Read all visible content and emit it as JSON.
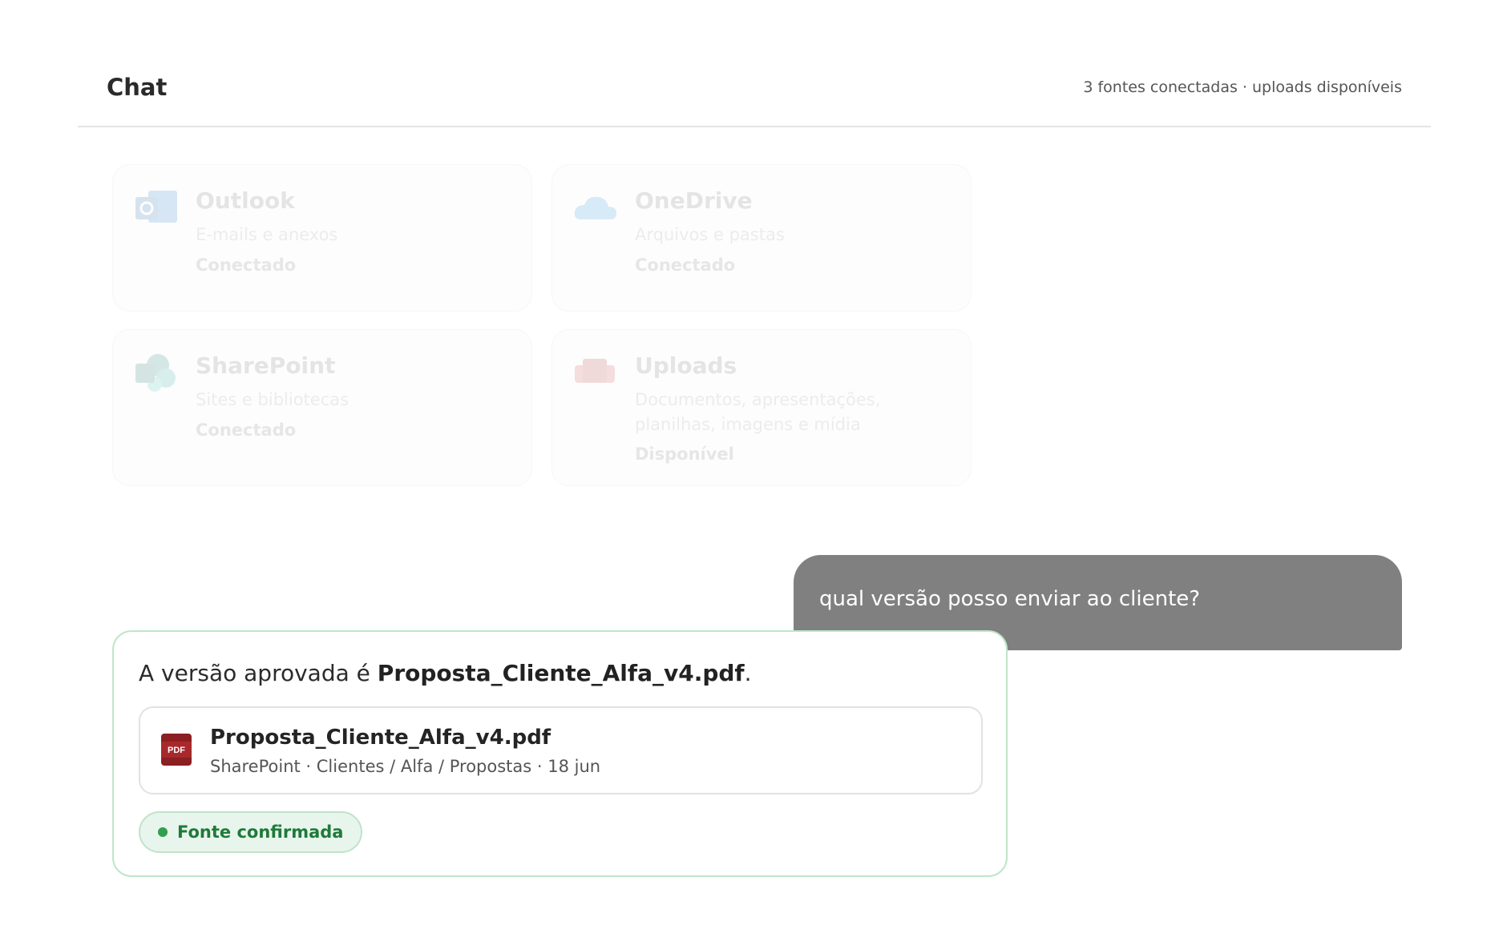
{
  "header": {
    "title": "Chat",
    "status": "3 fontes conectadas · uploads disponíveis"
  },
  "sources": [
    {
      "name": "Outlook",
      "description": "E-mails e anexos",
      "status": "Conectado",
      "icon": "outlook-icon"
    },
    {
      "name": "OneDrive",
      "description": "Arquivos e pastas",
      "status": "Conectado",
      "icon": "onedrive-icon"
    },
    {
      "name": "SharePoint",
      "description": "Sites e bibliotecas",
      "status": "Conectado",
      "icon": "sharepoint-icon"
    },
    {
      "name": "Uploads",
      "description": "Documentos, apresentações, planilhas, imagens e mídia",
      "status": "Disponível",
      "icon": "pdf-upload-icon"
    }
  ],
  "conversation": {
    "user_message": "qual versão posso enviar ao cliente?",
    "answer": {
      "prefix": "A versão aprovada é ",
      "file_highlight": "Proposta_Cliente_Alfa_v4.pdf",
      "suffix": ".",
      "file": {
        "icon": "pdf-file-icon",
        "icon_label": "PDF",
        "name": "Proposta_Cliente_Alfa_v4.pdf",
        "meta": "SharePoint · Clientes / Alfa / Propostas · 18 jun"
      },
      "badge": "Fonte confirmada"
    }
  },
  "colors": {
    "user_bubble": "#808080",
    "answer_border": "#bfe6c8",
    "badge_bg": "#e8f5ec",
    "badge_text": "#1f7a3a",
    "pdf_red": "#8b1f22"
  }
}
